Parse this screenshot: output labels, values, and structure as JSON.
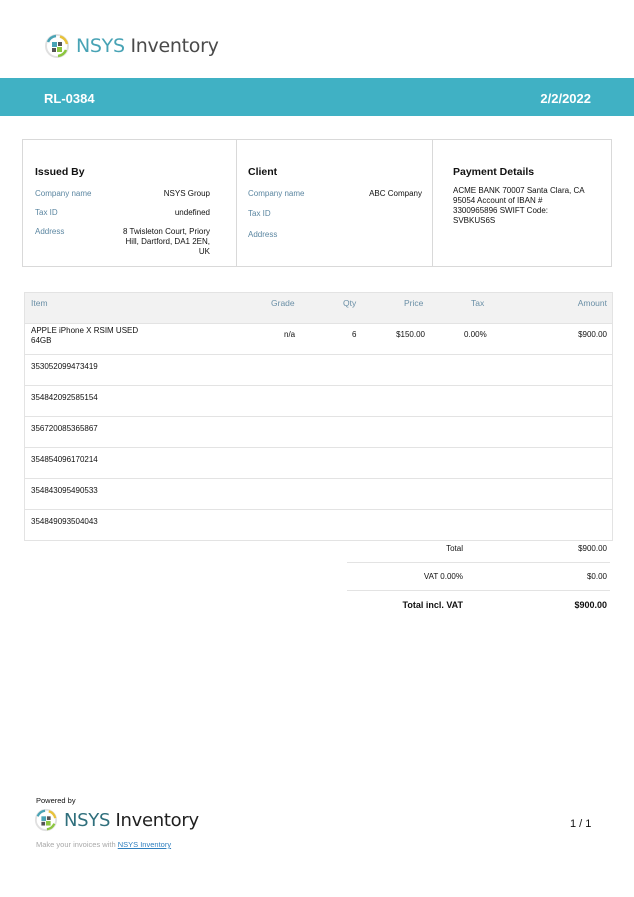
{
  "brand": {
    "name_part1": "NSYS",
    "name_part2": "Inventory"
  },
  "header": {
    "invoice_ref": "RL-0384",
    "date": "2/2/2022"
  },
  "issued_by": {
    "title": "Issued By",
    "company_label": "Company name",
    "company_value": "NSYS Group",
    "taxid_label": "Tax ID",
    "taxid_value": "undefined",
    "address_label": "Address",
    "address_line1": "8 Twisleton Court, Priory",
    "address_line2": "Hill, Dartford, DA1 2EN,",
    "address_line3": "UK"
  },
  "client": {
    "title": "Client",
    "company_label": "Company name",
    "company_value": "ABC Company",
    "taxid_label": "Tax ID",
    "address_label": "Address"
  },
  "payment": {
    "title": "Payment Details",
    "line1": "ACME BANK 70007 Santa Clara, CA",
    "line2": "95054  Account of IBAN #",
    "line3": "3300965896 SWIFT Code:",
    "line4": "SVBKUS6S"
  },
  "table": {
    "headers": {
      "item": "Item",
      "grade": "Grade",
      "qty": "Qty",
      "price": "Price",
      "tax": "Tax",
      "amount": "Amount"
    },
    "product": {
      "name_line1": "APPLE iPhone X RSIM USED",
      "name_line2": "64GB",
      "grade": "n/a",
      "qty": "6",
      "price": "$150.00",
      "tax": "0.00%",
      "amount": "$900.00"
    },
    "serials": [
      "353052099473419",
      "354842092585154",
      "356720085365867",
      "354854096170214",
      "354843095490533",
      "354849093504043"
    ]
  },
  "totals": {
    "total_label": "Total",
    "total_value": "$900.00",
    "vat_label": "VAT 0.00%",
    "vat_value": "$0.00",
    "grand_label": "Total incl. VAT",
    "grand_value": "$900.00"
  },
  "footer": {
    "powered_by": "Powered by",
    "note_prefix": "Make your invoices with",
    "note_link": "NSYS Inventory",
    "page_number": "1 / 1"
  }
}
